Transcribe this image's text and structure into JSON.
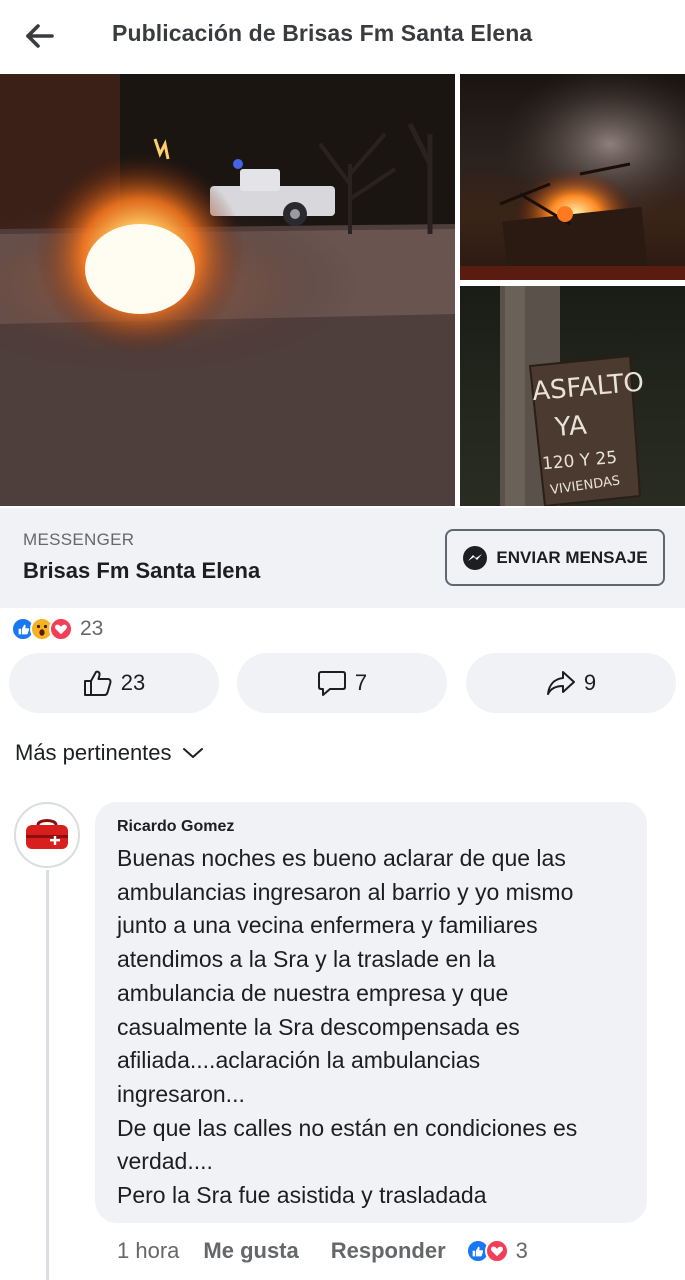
{
  "header": {
    "title": "Publicación de Brisas Fm Santa Elena",
    "back_icon": "arrow-left-icon"
  },
  "photos": {
    "sign_text": [
      "ASFALTO",
      "YA",
      "120 Y 25",
      "VIVIENDAS"
    ]
  },
  "messenger": {
    "label": "MESSENGER",
    "page_name": "Brisas Fm Santa Elena",
    "button_label": "ENVIAR MENSAJE",
    "button_icon": "messenger-icon"
  },
  "reactions": {
    "icons": [
      "like-icon",
      "wow-icon",
      "love-icon"
    ],
    "total": "23"
  },
  "actions": {
    "like_count": "23",
    "comment_count": "7",
    "share_count": "9"
  },
  "sort": {
    "label": "Más pertinentes",
    "icon": "chevron-down-icon"
  },
  "comment": {
    "author": "Ricardo Gomez",
    "lines": [
      "Buenas noches es bueno aclarar de que las",
      "ambulancias ingresaron al barrio y yo mismo",
      "junto a una vecina enfermera y familiares",
      "atendimos a la Sra y la traslade en la",
      "ambulancia de nuestra empresa y que",
      "casualmente la Sra descompensada es",
      "afiliada....aclaración la ambulancias",
      "ingresaron...",
      "De que las calles no están en condiciones es",
      "verdad....",
      "Pero la Sra fue asistida y trasladada"
    ],
    "time": "1 hora",
    "like_label": "Me gusta",
    "reply_label": "Responder",
    "reaction_count": "3"
  },
  "colors": {
    "facebook_blue": "#1877f2",
    "love_red": "#f33e58",
    "wow_yellow": "#f7b125",
    "surface_gray": "#f0f2f5",
    "secondary_text": "#65676b"
  }
}
